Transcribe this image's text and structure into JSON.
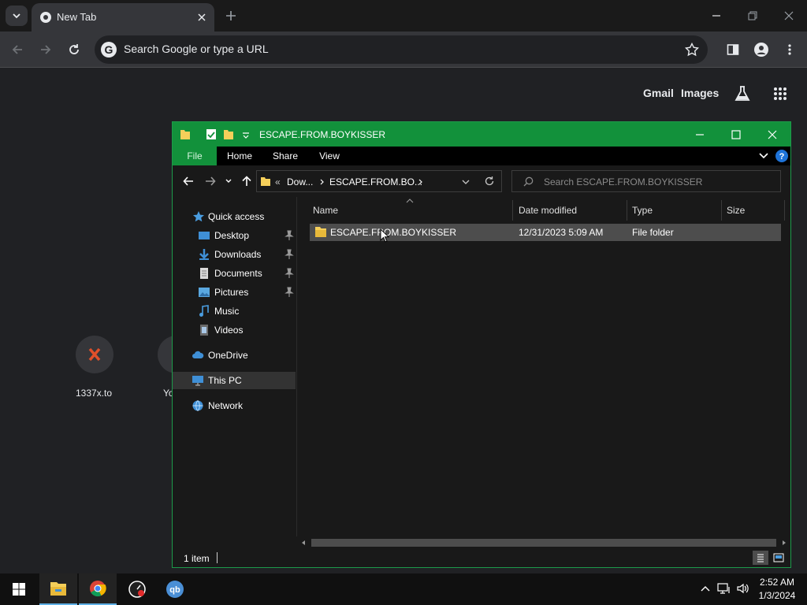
{
  "chrome": {
    "tab": {
      "title": "New Tab"
    },
    "omnibox": {
      "placeholder": "Search Google or type a URL"
    },
    "ntp": {
      "gmail": "Gmail",
      "images": "Images"
    },
    "shortcuts": [
      {
        "label": "1337x.to"
      },
      {
        "label": "Yo"
      }
    ]
  },
  "explorer": {
    "title": "ESCAPE.FROM.BOYKISSER",
    "ribbon_tabs": [
      "File",
      "Home",
      "Share",
      "View"
    ],
    "address": {
      "prefix": "«",
      "segment1": "Dow...",
      "segment2": "ESCAPE.FROM.BO..."
    },
    "search": {
      "placeholder": "Search ESCAPE.FROM.BOYKISSER"
    },
    "nav": {
      "quick_access": "Quick access",
      "items": [
        {
          "label": "Desktop",
          "pinned": true
        },
        {
          "label": "Downloads",
          "pinned": true
        },
        {
          "label": "Documents",
          "pinned": true
        },
        {
          "label": "Pictures",
          "pinned": true
        },
        {
          "label": "Music",
          "pinned": false
        },
        {
          "label": "Videos",
          "pinned": false
        }
      ],
      "onedrive": "OneDrive",
      "this_pc": "This PC",
      "network": "Network"
    },
    "columns": [
      "Name",
      "Date modified",
      "Type",
      "Size"
    ],
    "files": [
      {
        "name": "ESCAPE.FROM.BOYKISSER",
        "date": "12/31/2023 5:09 AM",
        "type": "File folder",
        "size": ""
      }
    ],
    "status": "1 item"
  },
  "taskbar": {
    "clock_time": "2:52 AM",
    "clock_date": "1/3/2024"
  },
  "colors": {
    "accent_green": "#12913b",
    "chrome_dark": "#35363a",
    "selection": "#4d4d4d"
  }
}
